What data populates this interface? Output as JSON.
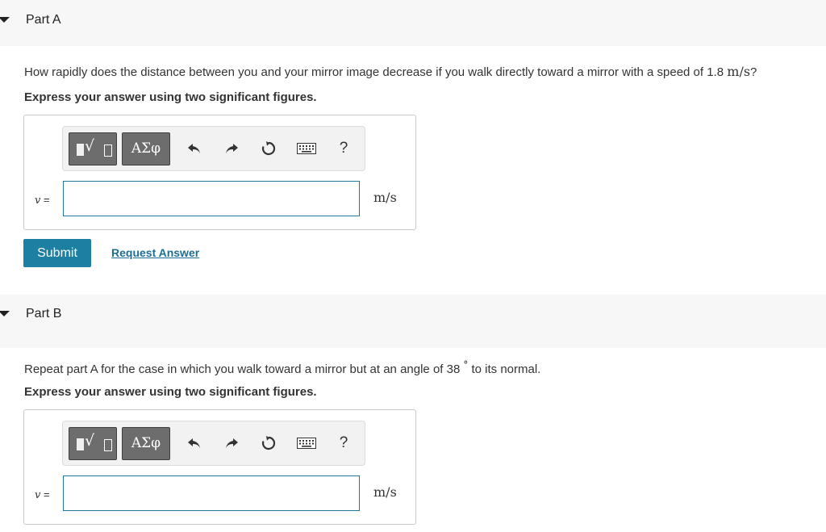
{
  "parts": [
    {
      "title": "Part A",
      "question": {
        "before": "How rapidly does the distance between you and your mirror image decrease if you walk directly toward a mirror with a speed of 1.8 ",
        "math": "m/s",
        "after": "?"
      },
      "instruction": "Express your answer using two significant figures.",
      "variable": "v",
      "equals": " =",
      "input_value": "",
      "unit": "m/s"
    },
    {
      "title": "Part B",
      "question": {
        "before": "Repeat part A for the case in which you walk toward a mirror but at an angle of 38",
        "math": "°",
        "after": " to its normal."
      },
      "instruction": "Express your answer using two significant figures.",
      "variable": "v",
      "equals": " =",
      "input_value": "",
      "unit": "m/s"
    }
  ],
  "toolbar": {
    "templates_icon": "templates-icon",
    "symbols_label": "ΑΣφ",
    "undo_icon": "undo-icon",
    "redo_icon": "redo-icon",
    "reset_icon": "reset-icon",
    "keyboard_icon": "keyboard-icon",
    "help_label": "?"
  },
  "actions": {
    "submit_label": "Submit",
    "request_answer_label": "Request Answer"
  },
  "colors": {
    "accent": "#1d7fa1",
    "link": "#1d6e92",
    "header_bg": "#f7f7f7",
    "input_border": "#1f7a98"
  }
}
